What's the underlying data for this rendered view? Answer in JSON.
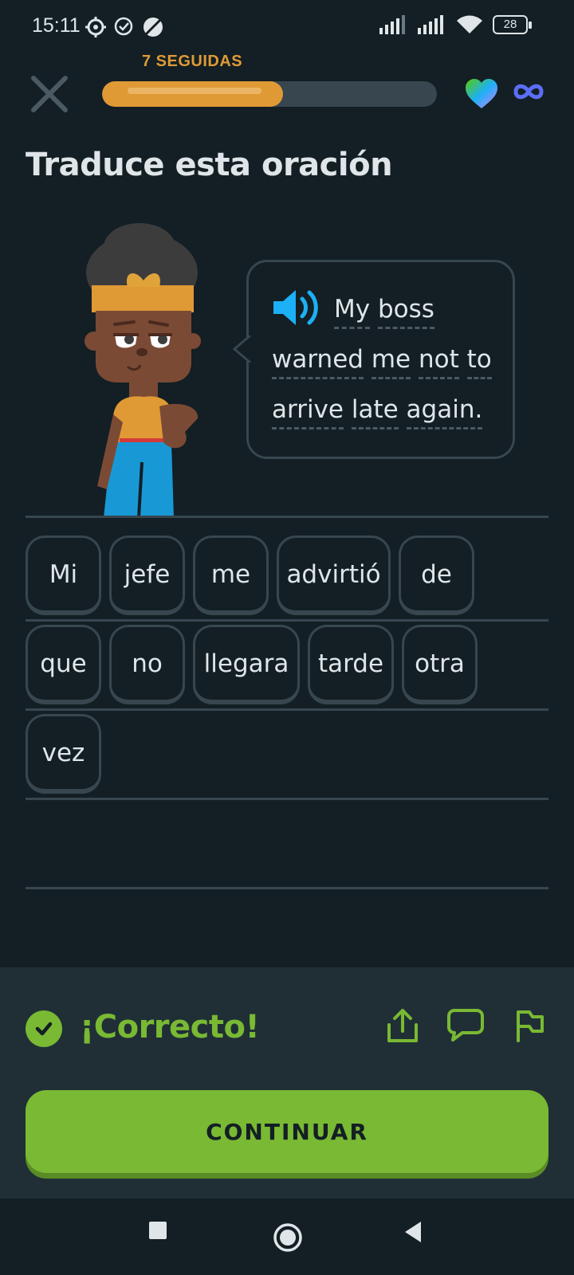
{
  "status_bar": {
    "time": "15:11",
    "battery": "28",
    "icons": [
      "gear-icon",
      "check-circle-icon",
      "no-sync-icon",
      "signal-icon",
      "signal-icon",
      "wifi-icon",
      "battery-icon"
    ]
  },
  "header": {
    "streak_label": "7 SEGUIDAS",
    "progress_fraction": 0.54,
    "close_icon": "close-icon",
    "hearts_icon": "heart-icon",
    "hearts_value": "infinity"
  },
  "exercise": {
    "title": "Traduce esta oración",
    "prompt_words": [
      "My",
      "boss",
      "warned",
      "me",
      "not",
      "to",
      "arrive",
      "late",
      "again."
    ]
  },
  "answer": {
    "rows": [
      [
        "Mi",
        "jefe",
        "me",
        "advirtió",
        "de"
      ],
      [
        "que",
        "no",
        "llegara",
        "tarde",
        "otra"
      ],
      [
        "vez"
      ]
    ]
  },
  "feedback": {
    "status": "¡Correcto!",
    "continue_label": "CONTINUAR",
    "icons": [
      "share-icon",
      "comment-icon",
      "flag-icon"
    ]
  },
  "colors": {
    "background": "#131f24",
    "accent_green": "#79b933",
    "streak_orange": "#e09a35",
    "border": "#37464f",
    "speaker_blue": "#1cb0f6"
  }
}
